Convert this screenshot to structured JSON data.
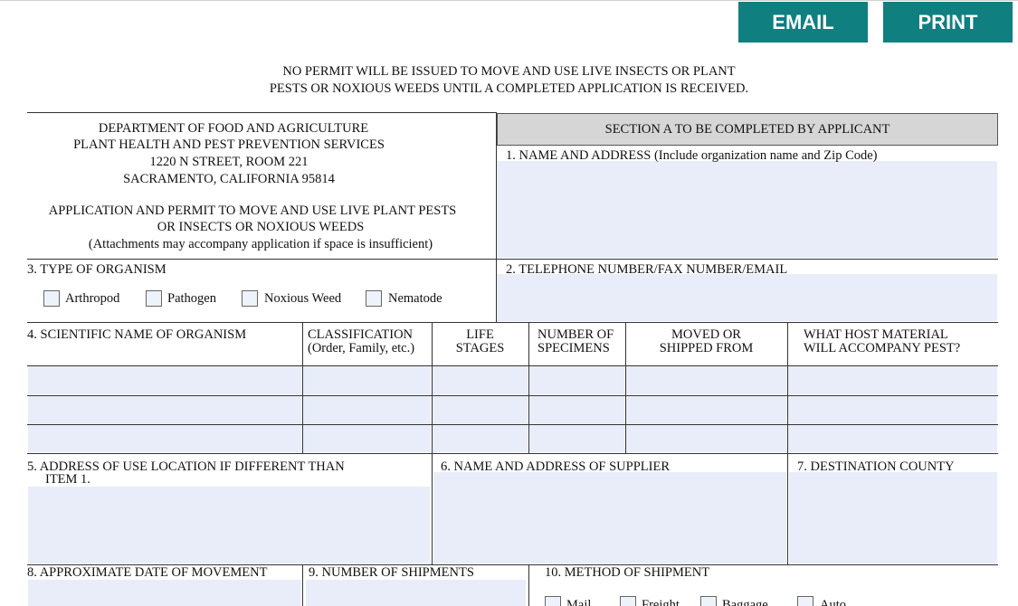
{
  "toolbar": {
    "email_label": "EMAIL",
    "print_label": "PRINT"
  },
  "notice": {
    "line1": "NO PERMIT WILL BE ISSUED TO MOVE AND USE LIVE INSECTS OR PLANT",
    "line2": "PESTS OR NOXIOUS WEEDS UNTIL A COMPLETED APPLICATION IS RECEIVED."
  },
  "department": {
    "line1": "DEPARTMENT OF FOOD AND AGRICULTURE",
    "line2": "PLANT HEALTH AND PEST PREVENTION SERVICES",
    "line3": "1220 N STREET, ROOM 221",
    "line4": "SACRAMENTO, CALIFORNIA  95814"
  },
  "form_title": {
    "line1": "APPLICATION AND PERMIT TO MOVE AND USE LIVE PLANT PESTS",
    "line2": "OR INSECTS OR NOXIOUS WEEDS",
    "line3": "(Attachments may accompany application if space is insufficient)"
  },
  "section_a": "SECTION A TO BE COMPLETED BY APPLICANT",
  "fields": {
    "f1": "1.  NAME AND ADDRESS (Include organization name and Zip Code)",
    "f2": "2.  TELEPHONE NUMBER/FAX NUMBER/EMAIL",
    "f3": "3.  TYPE OF ORGANISM",
    "f4": "4.  SCIENTIFIC NAME OF ORGANISM",
    "f5_line1": "5.  ADDRESS OF USE LOCATION IF DIFFERENT THAN",
    "f5_line2": "ITEM 1.",
    "f6": "6.  NAME AND ADDRESS OF SUPPLIER",
    "f7": "7.  DESTINATION COUNTY",
    "f8": "8.  APPROXIMATE DATE OF MOVEMENT",
    "f9": "9.  NUMBER OF SHIPMENTS",
    "f10": "10.  METHOD OF SHIPMENT"
  },
  "organism_types": [
    "Arthropod",
    "Pathogen",
    "Noxious Weed",
    "Nematode"
  ],
  "columns": {
    "classification": [
      "CLASSIFICATION",
      "(Order, Family, etc.)"
    ],
    "life_stages": [
      "LIFE",
      "STAGES"
    ],
    "specimens": [
      "NUMBER OF",
      "SPECIMENS"
    ],
    "moved_from": [
      "MOVED OR",
      "SHIPPED FROM"
    ],
    "host_material": [
      "WHAT HOST MATERIAL",
      "WILL ACCOMPANY PEST?"
    ]
  },
  "shipment_methods": [
    "Mail",
    "Freight",
    "Baggage",
    "Auto"
  ],
  "colors": {
    "button": "#0f7f7f",
    "field_fill": "#e8edf9",
    "section_header": "#d6d6d6"
  }
}
